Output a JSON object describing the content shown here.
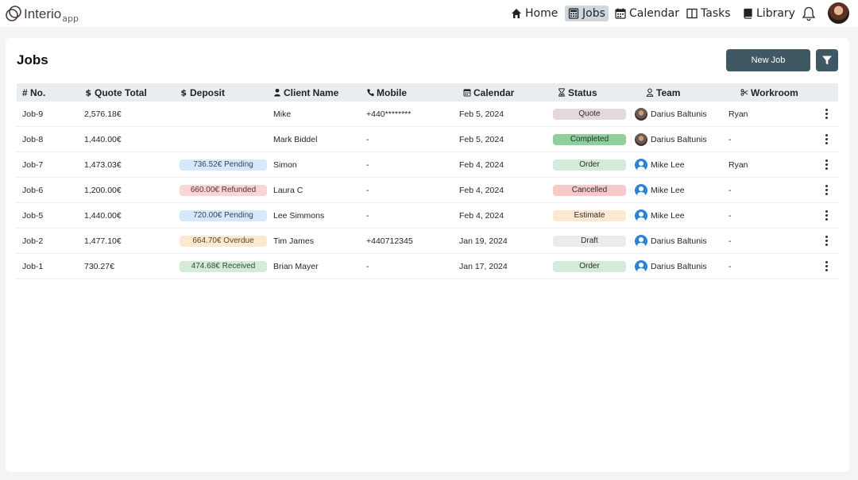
{
  "app": {
    "logo_text": "Interio",
    "logo_sub": "app"
  },
  "nav": {
    "home": "Home",
    "jobs": "Jobs",
    "calendar": "Calendar",
    "tasks": "Tasks",
    "library": "Library",
    "active": "jobs"
  },
  "icons": {
    "home": "home-icon",
    "jobs": "calculator-icon",
    "calendar": "calendar-icon",
    "tasks": "columns-icon",
    "library": "book-icon",
    "notifications": "bell-icon",
    "filter": "filter-icon",
    "row_menu": "kebab-menu-icon"
  },
  "page": {
    "title": "Jobs",
    "new_job_label": "New Job"
  },
  "table": {
    "headers": {
      "no": "# No.",
      "quote_total": "Quote Total",
      "deposit": "Deposit",
      "client_name": "Client Name",
      "mobile": "Mobile",
      "calendar": "Calendar",
      "status": "Status",
      "team": "Team",
      "workroom": "Workroom"
    },
    "rows": [
      {
        "no": "Job-9",
        "quote_total": "2,576.18€",
        "deposit": "",
        "deposit_kind": "none",
        "client": "Mike",
        "mobile": "+440********",
        "date": "Feb 5, 2024",
        "status": "Quote",
        "team": "Darius Baltunis",
        "team_avatar": "photo",
        "workroom": "Ryan"
      },
      {
        "no": "Job-8",
        "quote_total": "1,440.00€",
        "deposit": "",
        "deposit_kind": "none",
        "client": "Mark Biddel",
        "mobile": "-",
        "date": "Feb 5, 2024",
        "status": "Completed",
        "team": "Darius Baltunis",
        "team_avatar": "photo",
        "workroom": "-"
      },
      {
        "no": "Job-7",
        "quote_total": "1,473.03€",
        "deposit": "736.52€ Pending",
        "deposit_kind": "pending",
        "client": "Simon",
        "mobile": "-",
        "date": "Feb 4, 2024",
        "status": "Order",
        "team": "Mike Lee",
        "team_avatar": "default",
        "workroom": "Ryan"
      },
      {
        "no": "Job-6",
        "quote_total": "1,200.00€",
        "deposit": "660.00€ Refunded",
        "deposit_kind": "refunded",
        "client": "Laura C",
        "mobile": "-",
        "date": "Feb 4, 2024",
        "status": "Cancelled",
        "team": "Mike Lee",
        "team_avatar": "default",
        "workroom": "-"
      },
      {
        "no": "Job-5",
        "quote_total": "1,440.00€",
        "deposit": "720.00€ Pending",
        "deposit_kind": "pending",
        "client": "Lee Simmons",
        "mobile": "-",
        "date": "Feb 4, 2024",
        "status": "Estimate",
        "team": "Mike Lee",
        "team_avatar": "default",
        "workroom": "-"
      },
      {
        "no": "Job-2",
        "quote_total": "1,477.10€",
        "deposit": "664.70€ Overdue",
        "deposit_kind": "overdue",
        "client": "Tim James",
        "mobile": "+440712345",
        "date": "Jan 19, 2024",
        "status": "Draft",
        "team": "Darius Baltunis",
        "team_avatar": "default",
        "workroom": "-"
      },
      {
        "no": "Job-1",
        "quote_total": "730.27€",
        "deposit": "474.68€ Received",
        "deposit_kind": "received",
        "client": "Brian Mayer",
        "mobile": "-",
        "date": "Jan 17, 2024",
        "status": "Order",
        "team": "Darius Baltunis",
        "team_avatar": "default",
        "workroom": "-"
      }
    ]
  },
  "colors": {
    "accent": "#3f5863",
    "header_bg": "#e9edf0",
    "nav_active_bg": "#cfd6dc",
    "deposit": {
      "pending": {
        "bg": "#d6e8fb",
        "fg": "#34495e"
      },
      "refunded": {
        "bg": "#f9d5d5",
        "fg": "#5b2f2f"
      },
      "overdue": {
        "bg": "#fde9cf",
        "fg": "#5a4426"
      },
      "received": {
        "bg": "#d3ebd8",
        "fg": "#2e4d35"
      }
    },
    "status": {
      "Quote": "#e4d8dd",
      "Completed": "#8fcf9a",
      "Order": "#d3ebd8",
      "Cancelled": "#f7c9c9",
      "Estimate": "#fde9cf",
      "Draft": "#e8ecef"
    }
  }
}
